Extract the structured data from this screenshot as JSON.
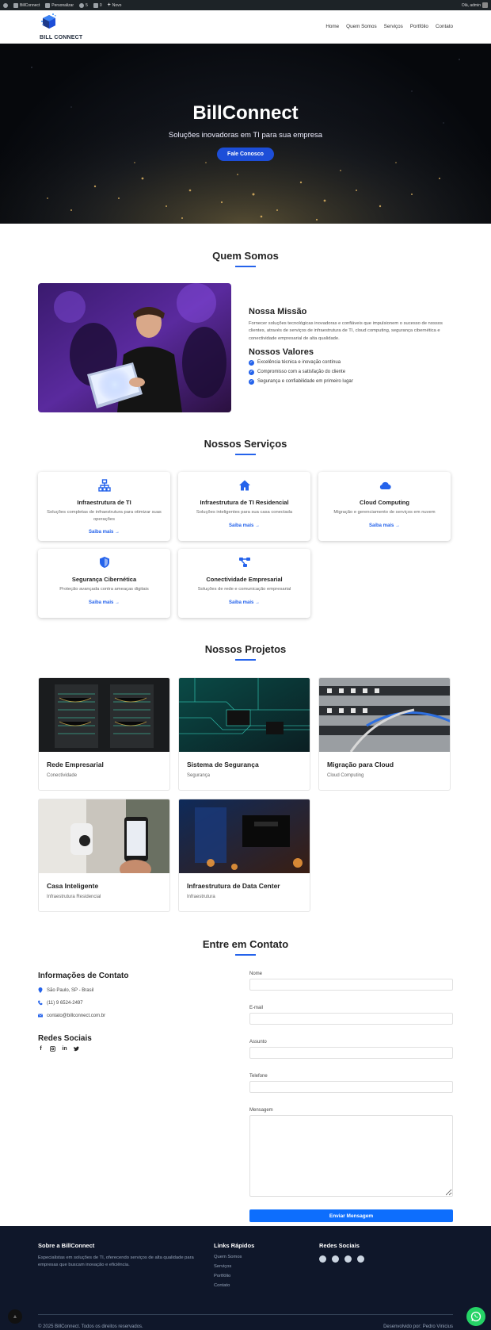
{
  "adminbar": {
    "site": "BillConnect",
    "customize": "Personalizar",
    "updates": "5",
    "comments": "0",
    "new": "Novo",
    "greeting": "Olá, admin"
  },
  "header": {
    "logo_text": "BILL CONNECT",
    "nav": [
      "Home",
      "Quem Somos",
      "Serviços",
      "Portfólio",
      "Contato"
    ]
  },
  "hero": {
    "title": "BillConnect",
    "subtitle": "Soluções inovadoras em TI para sua empresa",
    "cta": "Fale Conosco"
  },
  "about": {
    "title": "Quem Somos",
    "mission_title": "Nossa Missão",
    "mission_text": "Fornecer soluções tecnológicas inovadoras e confiáveis que impulsionem o sucesso de nossos clientes, através de serviços de infraestrutura de TI, cloud computing, segurança cibernética e conectividade empresarial de alta qualidade.",
    "values_title": "Nossos Valores",
    "values": [
      "Excelência técnica e inovação contínua",
      "Compromisso com a satisfação do cliente",
      "Segurança e confiabilidade em primeiro lugar"
    ]
  },
  "services": {
    "title": "Nossos Serviços",
    "link_label": "Saiba mais",
    "items": [
      {
        "title": "Infraestrutura de TI",
        "desc": "Soluções completas de infraestrutura para otimizar suas operações",
        "icon": "network-icon"
      },
      {
        "title": "Infraestrutura de TI Residencial",
        "desc": "Soluções inteligentes para sua casa conectada",
        "icon": "home-icon"
      },
      {
        "title": "Cloud Computing",
        "desc": "Migração e gerenciamento de serviços em nuvem",
        "icon": "cloud-icon"
      },
      {
        "title": "Segurança Cibernética",
        "desc": "Proteção avançada contra ameaças digitais",
        "icon": "shield-icon"
      },
      {
        "title": "Conectividade Empresarial",
        "desc": "Soluções de rede e comunicação empresarial",
        "icon": "connection-icon"
      }
    ]
  },
  "projects": {
    "title": "Nossos Projetos",
    "items": [
      {
        "title": "Rede Empresarial",
        "category": "Conectividade"
      },
      {
        "title": "Sistema de Segurança",
        "category": "Segurança"
      },
      {
        "title": "Migração para Cloud",
        "category": "Cloud Computing"
      },
      {
        "title": "Casa Inteligente",
        "category": "Infraestrutura Residencial"
      },
      {
        "title": "Infraestrutura de Data Center",
        "category": "Infraestrutura"
      }
    ]
  },
  "contact": {
    "title": "Entre em Contato",
    "info_title": "Informações de Contato",
    "address": "São Paulo, SP - Brasil",
    "phone": "(11) 9 6524-2497",
    "email": "contato@billconnect.com.br",
    "social_title": "Redes Sociais",
    "form": {
      "name_label": "Nome",
      "email_label": "E-mail",
      "subject_label": "Assunto",
      "phone_label": "Telefone",
      "message_label": "Mensagem",
      "name_value": "",
      "email_value": "",
      "subject_value": "",
      "phone_value": "",
      "message_value": "",
      "submit": "Enviar Mensagem"
    }
  },
  "footer": {
    "about_title": "Sobre a BillConnect",
    "about_text": "Especialistas em soluções de TI, oferecendo serviços de alta qualidade para empresas que buscam inovação e eficiência.",
    "links_title": "Links Rápidos",
    "links": [
      "Quem Somos",
      "Serviços",
      "Portfólio",
      "Contato"
    ],
    "social_title": "Redes Sociais",
    "copyright": "© 2025 BillConnect. Todos os direitos reservados.",
    "credit": "Desenvolvido por: Pedro Vinicius"
  },
  "colors": {
    "accent": "#2563eb",
    "hero_button": "#1d4ed8",
    "submit": "#0d6efd",
    "footer_bg": "#0f172a",
    "whatsapp": "#25d366"
  }
}
